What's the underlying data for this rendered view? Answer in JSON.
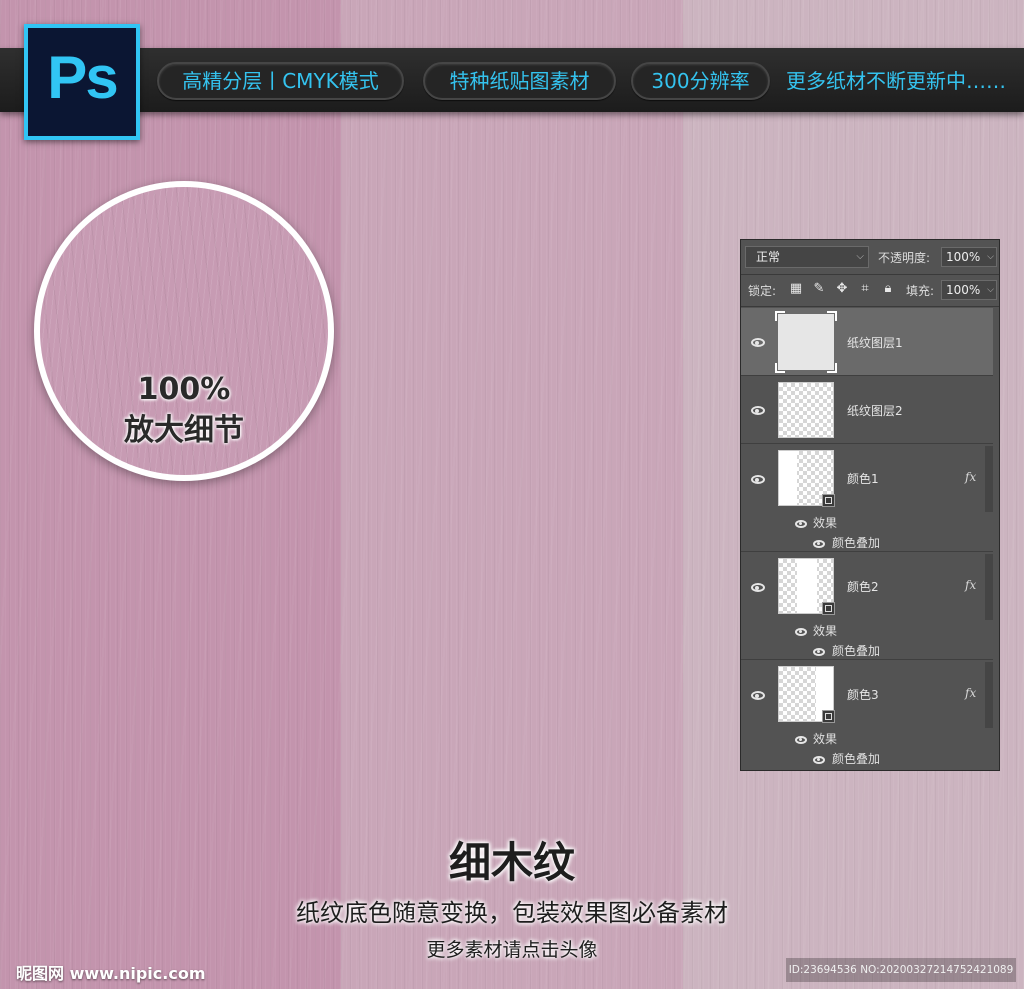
{
  "banner": {
    "logo": "Ps",
    "tags": [
      "高精分层丨CMYK模式",
      "特种纸贴图素材",
      "300分辨率"
    ],
    "tail": "更多纸材不断更新中……"
  },
  "magnifier": {
    "percent": "100%",
    "caption": "放大细节"
  },
  "layers_panel": {
    "blend_mode": "正常",
    "opacity_label": "不透明度:",
    "opacity_value": "100%",
    "lock_label": "锁定:",
    "fill_label": "填充:",
    "fill_value": "100%",
    "lock_icons": [
      "lock-transparent-icon",
      "brush-icon",
      "move-icon",
      "crop-icon",
      "lock-icon"
    ],
    "layers": [
      {
        "name": "纸纹图层1",
        "selected": true
      },
      {
        "name": "纸纹图层2",
        "selected": false
      },
      {
        "name": "颜色1",
        "fx": "fx",
        "effects_label": "效果",
        "effect": "颜色叠加"
      },
      {
        "name": "颜色2",
        "fx": "fx",
        "effects_label": "效果",
        "effect": "颜色叠加"
      },
      {
        "name": "颜色3",
        "fx": "fx",
        "effects_label": "效果",
        "effect": "颜色叠加"
      }
    ]
  },
  "footer": {
    "title": "细木纹",
    "subtitle": "纸纹底色随意变换，包装效果图必备素材",
    "note": "更多素材请点击头像",
    "watermark_left": "昵图网 www.nipic.com",
    "watermark_right": "ID:23694536 NO:20200327214752421089"
  },
  "colors": {
    "panel_left": "#c394ad",
    "panel_mid": "#c9a6b8",
    "panel_right": "#ccb4c0",
    "accent_cyan": "#34c3ef"
  }
}
